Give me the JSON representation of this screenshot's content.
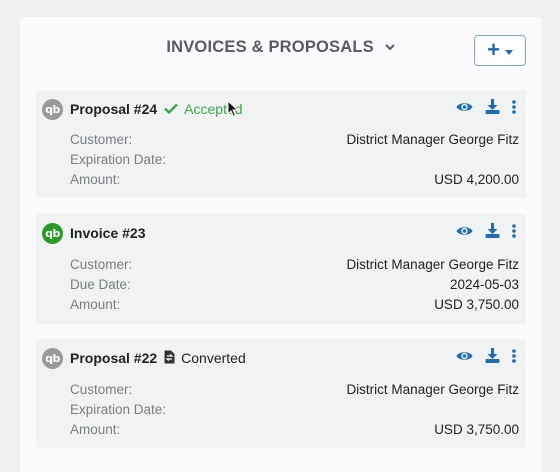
{
  "header": {
    "title": "INVOICES & PROPOSALS",
    "add_label": "+"
  },
  "cards": [
    {
      "title": "Proposal #24",
      "status": "Accepted",
      "rows": [
        {
          "label": "Customer:",
          "value": "District Manager George Fitz"
        },
        {
          "label": "Expiration Date:",
          "value": ""
        },
        {
          "label": "Amount:",
          "value": "USD 4,200.00"
        }
      ]
    },
    {
      "title": "Invoice #23",
      "status": "",
      "rows": [
        {
          "label": "Customer:",
          "value": "District Manager George Fitz"
        },
        {
          "label": "Due Date:",
          "value": "2024-05-03"
        },
        {
          "label": "Amount:",
          "value": "USD 3,750.00"
        }
      ]
    },
    {
      "title": "Proposal #22",
      "status": "Converted",
      "rows": [
        {
          "label": "Customer:",
          "value": "District Manager George Fitz"
        },
        {
          "label": "Expiration Date:",
          "value": ""
        },
        {
          "label": "Amount:",
          "value": "USD 3,750.00"
        }
      ]
    }
  ],
  "icons": {
    "qb_logo_text": "qb",
    "view": "eye-icon",
    "download": "download-icon",
    "more": "kebab-menu-icon",
    "accepted": "checkmark-icon",
    "converted": "document-convert-icon"
  },
  "colors": {
    "accent": "#1f6cb1",
    "accepted": "#3da451",
    "qb_green": "#2a9b24",
    "qb_gray": "#9a9a9a",
    "card_bg": "#f1f3f2"
  }
}
